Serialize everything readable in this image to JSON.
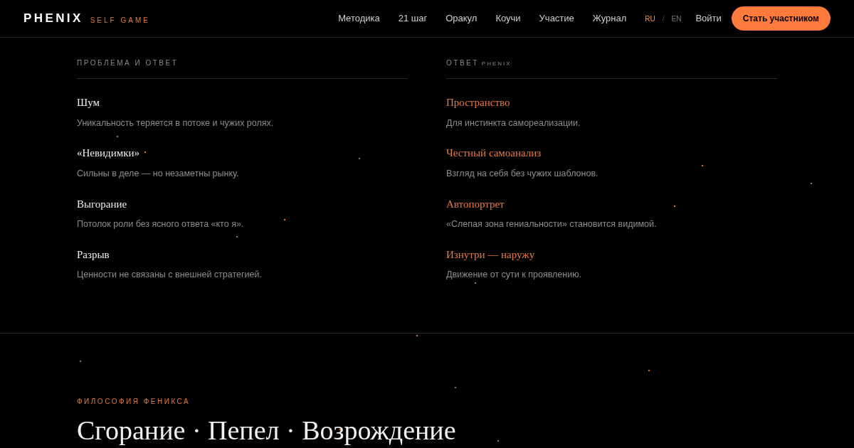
{
  "header": {
    "logo": "PHENIX",
    "tagline": "SELF GAME",
    "nav": [
      "Методика",
      "21 шаг",
      "Оракул",
      "Коучи",
      "Участие",
      "Журнал"
    ],
    "languages": [
      {
        "label": "RU",
        "selected": true
      },
      {
        "label": "EN",
        "selected": false
      }
    ],
    "separator": "/",
    "login": "Войти",
    "cta": "Стать участником"
  },
  "columns": [
    {
      "label": "ПРОБЛЕМА И ОТВЕТ",
      "accent": false,
      "items": [
        {
          "title": "Шум",
          "text": "Уникальность теряется в потоке и чужих ролях."
        },
        {
          "title": "«Невидимки»",
          "text": "Сильны в деле — но незаметны рынку."
        },
        {
          "title": "Выгорание",
          "text": "Потолок роли без ясного ответа «кто я»."
        },
        {
          "title": "Разрыв",
          "text": "Ценности не связаны с внешней стратегией."
        }
      ]
    },
    {
      "label": "ОТВЕТ",
      "label_suffix": "PHENIX",
      "accent": true,
      "items": [
        {
          "title": "Пространство",
          "text": "Для инстинкта самореализации."
        },
        {
          "title": "Честный самоанализ",
          "text": "Взгляд на себя без чужих шаблонов."
        },
        {
          "title": "Автопортрет",
          "text": "«Слепая зона гениальности» становится видимой."
        },
        {
          "title": "Изнутри — наружу",
          "text": "Движение от сути к проявлению."
        }
      ]
    }
  ],
  "philosophy": {
    "label": "ФИЛОСОФИЯ ФЕНИКСА",
    "heading": "Сгорание · Пепел · Возрождение"
  }
}
